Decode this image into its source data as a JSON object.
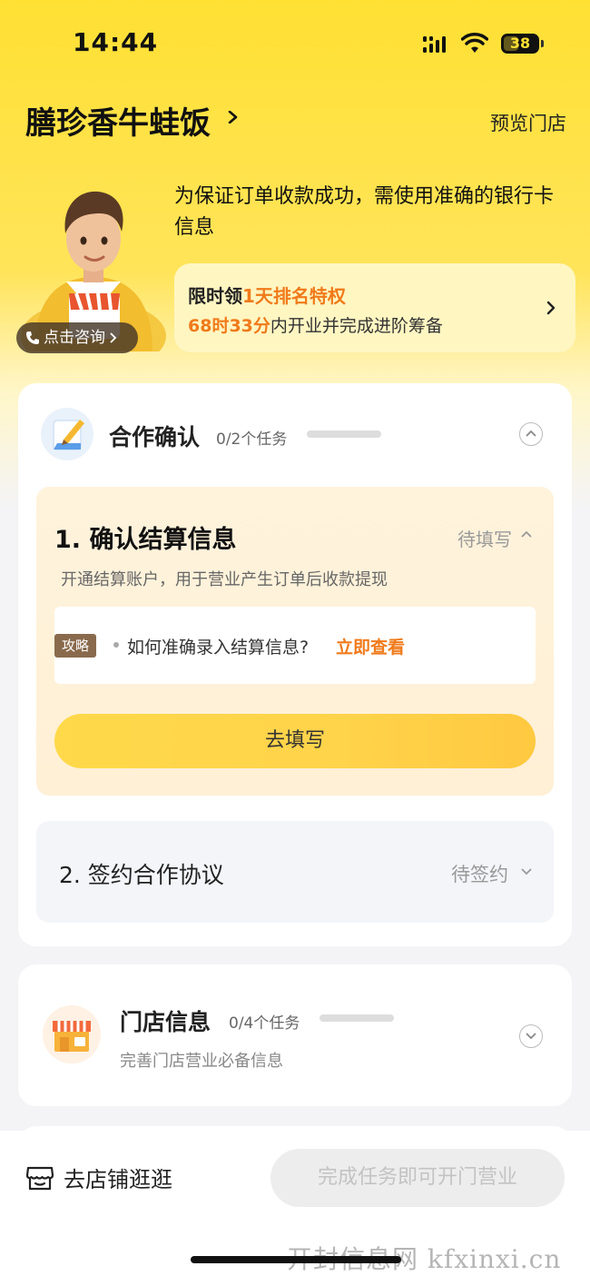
{
  "status_bar": {
    "time": "14:44",
    "battery": "38"
  },
  "header": {
    "store_name": "膳珍香牛蛙饭",
    "preview_label": "预览门店"
  },
  "banner": {
    "notice": "为保证订单收款成功，需使用准确的银行卡信息",
    "consult_label": "点击咨询",
    "promo_prefix": "限时领",
    "promo_highlight": "1天排名特权",
    "promo_time": "68时33分",
    "promo_suffix": "内开业并完成进阶筹备"
  },
  "cooperation_section": {
    "title": "合作确认",
    "task_count": "0/2个任务",
    "progress": 0,
    "tasks": [
      {
        "title": "1. 确认结算信息",
        "status": "待填写",
        "description": "开通结算账户，用于营业产生订单后收款提现",
        "guide_tag": "攻略",
        "guide_question": "如何准确录入结算信息?",
        "guide_link": "立即查看",
        "action_label": "去填写"
      },
      {
        "title": "2. 签约合作协议",
        "status": "待签约"
      }
    ]
  },
  "store_section": {
    "title": "门店信息",
    "task_count": "0/4个任务",
    "progress": 0,
    "subtitle": "完善门店营业必备信息"
  },
  "bottom_bar": {
    "shop_visit_label": "去店铺逛逛",
    "complete_label": "完成任务即可开门营业"
  },
  "watermark": "开封信息网 kfxinxi.cn",
  "colors": {
    "brand_yellow": "#ffe033",
    "accent_orange": "#f07a1a",
    "tag_brown": "#8a6a4d"
  }
}
